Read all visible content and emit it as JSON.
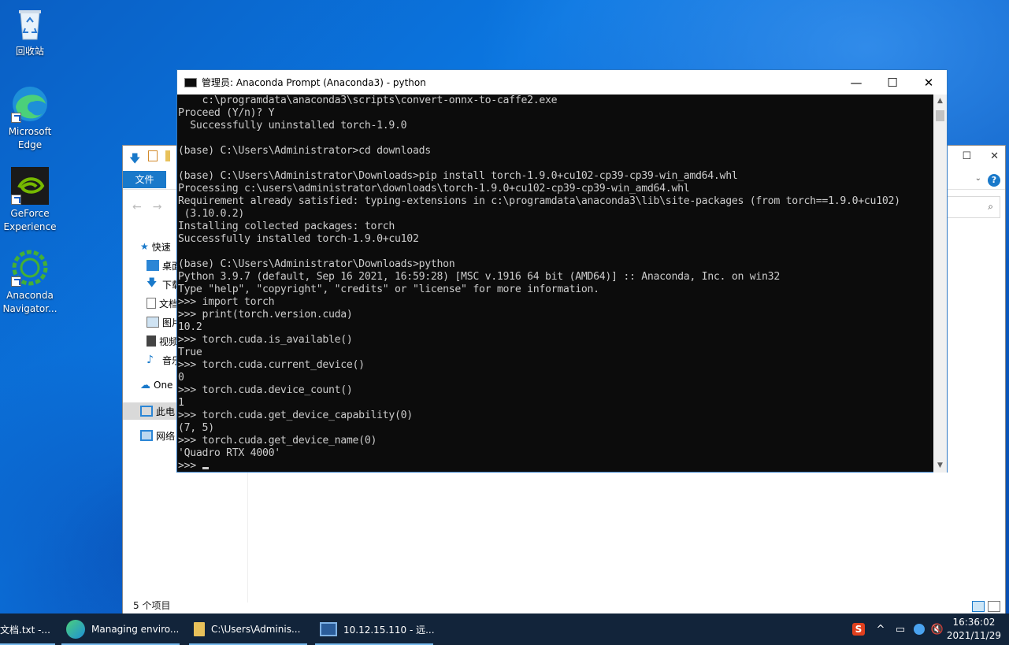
{
  "desktop": {
    "icons": [
      {
        "label": "回收站"
      },
      {
        "label": "Microsoft Edge"
      },
      {
        "label": "GeForce Experience"
      },
      {
        "label": "Anaconda Navigator..."
      }
    ]
  },
  "explorer": {
    "file_tab": "文件",
    "nav_items": [
      "快速",
      "桌面",
      "下载",
      "文档",
      "图片",
      "视频",
      "音乐",
      "One",
      "此电",
      "网络"
    ],
    "status": "5 个项目"
  },
  "console": {
    "title": "管理员: Anaconda Prompt (Anaconda3) - python",
    "minimize": "—",
    "maximize": "☐",
    "close": "✕",
    "lines": [
      "    c:\\programdata\\anaconda3\\scripts\\convert-onnx-to-caffe2.exe",
      "Proceed (Y/n)? Y",
      "  Successfully uninstalled torch-1.9.0",
      "",
      "(base) C:\\Users\\Administrator>cd downloads",
      "",
      "(base) C:\\Users\\Administrator\\Downloads>pip install torch-1.9.0+cu102-cp39-cp39-win_amd64.whl",
      "Processing c:\\users\\administrator\\downloads\\torch-1.9.0+cu102-cp39-cp39-win_amd64.whl",
      "Requirement already satisfied: typing-extensions in c:\\programdata\\anaconda3\\lib\\site-packages (from torch==1.9.0+cu102)",
      " (3.10.0.2)",
      "Installing collected packages: torch",
      "Successfully installed torch-1.9.0+cu102",
      "",
      "(base) C:\\Users\\Administrator\\Downloads>python",
      "Python 3.9.7 (default, Sep 16 2021, 16:59:28) [MSC v.1916 64 bit (AMD64)] :: Anaconda, Inc. on win32",
      "Type \"help\", \"copyright\", \"credits\" or \"license\" for more information.",
      ">>> import torch",
      ">>> print(torch.version.cuda)",
      "10.2",
      ">>> torch.cuda.is_available()",
      "True",
      ">>> torch.cuda.current_device()",
      "0",
      ">>> torch.cuda.device_count()",
      "1",
      ">>> torch.cuda.get_device_capability(0)",
      "(7, 5)",
      ">>> torch.cuda.get_device_name(0)",
      "'Quadro RTX 4000'"
    ],
    "prompt": ">>> "
  },
  "taskbar": {
    "tasks": [
      {
        "label": "文档.txt -..."
      },
      {
        "label": "Managing enviro..."
      },
      {
        "label": "C:\\Users\\Adminis..."
      },
      {
        "label": "10.12.15.110 - 远..."
      }
    ],
    "time": "16:36:02",
    "date": "2021/11/29"
  },
  "colors": {
    "accent": "#0078d7",
    "taskbar": "#12243a",
    "console_bg": "#0c0c0c",
    "console_fg": "#cccccc"
  }
}
